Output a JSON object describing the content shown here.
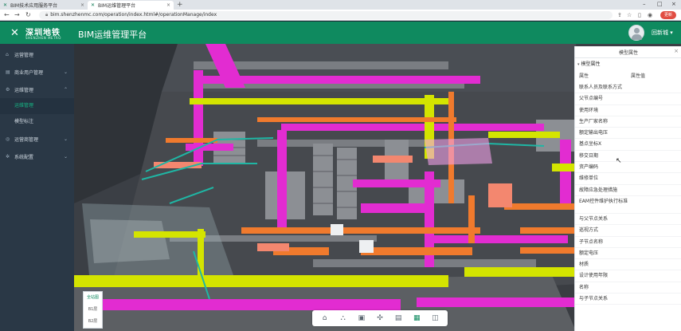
{
  "browser": {
    "tabs": [
      {
        "label": "BIM技术应用服务平台",
        "active": false
      },
      {
        "label": "BIM运维管理平台",
        "active": true
      }
    ],
    "new_tab": "+",
    "url": "bim.shenzhenmc.com/operation/index.html#/operationManage/index",
    "update_label": "更新"
  },
  "header": {
    "logo_cn": "深圳地铁",
    "logo_en": "SHENZHEN METRO",
    "title": "BIM运维管理平台",
    "user_name": "回新城 ▾",
    "brand_color": "#0f8a5f"
  },
  "sidebar": {
    "items": [
      {
        "label": "运营管理",
        "icon": "home-icon"
      },
      {
        "label": "商业用户管理",
        "icon": "shop-icon",
        "chevron": "⌄"
      },
      {
        "label": "运维管理",
        "icon": "wrench-icon",
        "chevron": "⌃"
      },
      {
        "label": "运营商管理",
        "icon": "users-icon",
        "chevron": "⌄"
      },
      {
        "label": "系统配置",
        "icon": "gear-icon",
        "chevron": "⌄"
      }
    ],
    "subitems": [
      {
        "label": "运维管理",
        "active": true
      },
      {
        "label": "模型标注",
        "active": false
      }
    ]
  },
  "floors": [
    {
      "label": "全站图",
      "active": true
    },
    {
      "label": "B1层",
      "active": false
    },
    {
      "label": "B2层",
      "active": false
    }
  ],
  "toolbar": [
    {
      "icon": "home-icon",
      "glyph": "⌂"
    },
    {
      "icon": "structure-icon",
      "glyph": "⛬"
    },
    {
      "icon": "cube-icon",
      "glyph": "▣"
    },
    {
      "icon": "fan-icon",
      "glyph": "✣"
    },
    {
      "icon": "section-box-icon",
      "glyph": "▤"
    },
    {
      "icon": "property-icon",
      "glyph": "▦",
      "active": true
    },
    {
      "icon": "split-view-icon",
      "glyph": "◫"
    }
  ],
  "panel": {
    "title": "模型属性",
    "close": "×",
    "group": "模型属性",
    "col_attr": "属性",
    "col_value": "属性值",
    "rows": [
      "联系人员及联系方式",
      "父节点编号",
      "使用环境",
      "生产厂家名称",
      "额定输出电压",
      "基点坐标X",
      "移交日期",
      "资产编码",
      "维修单位",
      "故障应急处理措施",
      "EAM控件维护执行标准",
      "与父节点关系",
      "巡视方式",
      "子节点名称",
      "额定电压",
      "材质",
      "设计使用年限",
      "名称",
      "与子节点关系"
    ]
  }
}
